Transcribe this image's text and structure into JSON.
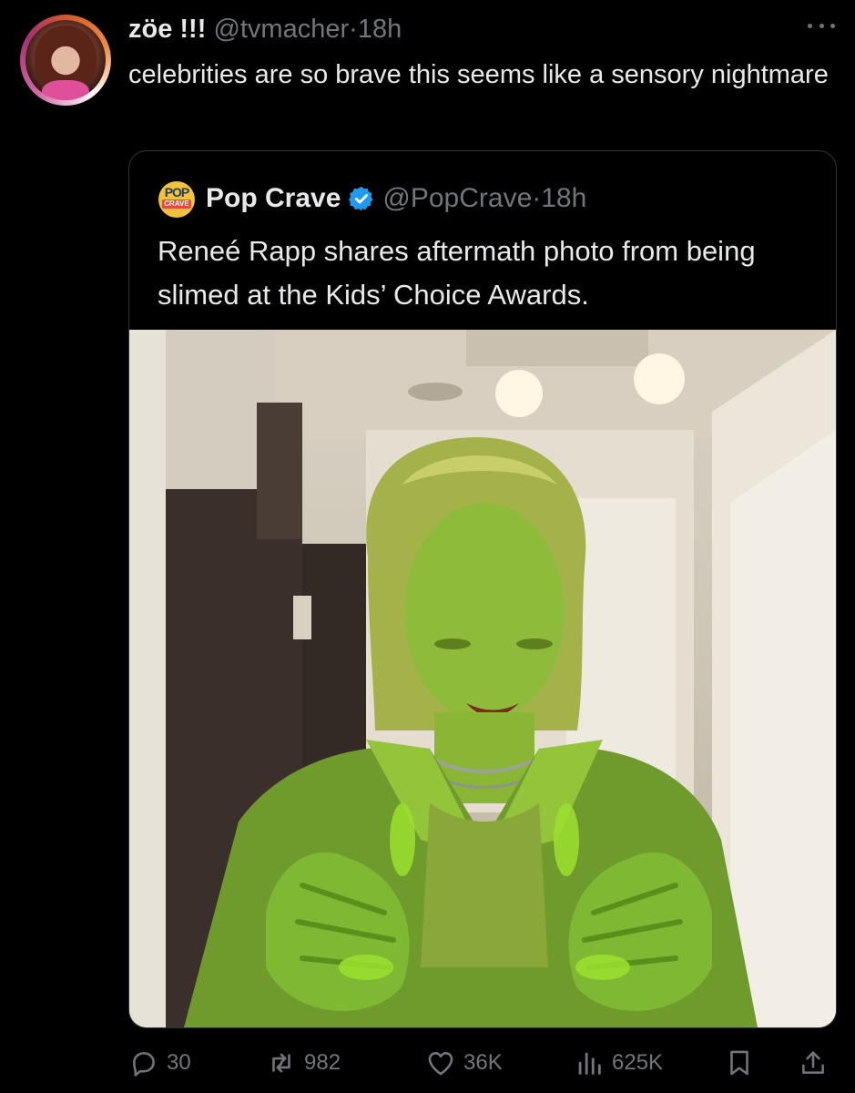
{
  "tweet": {
    "display_name": "zöe !!!",
    "handle": "@tvmacher",
    "separator": "·",
    "time": "18h",
    "text": "celebrities are so brave this seems like a sensory nightmare"
  },
  "quoted_tweet": {
    "logo_top": "POP",
    "logo_bottom": "CRAVE",
    "display_name": "Pop Crave",
    "handle": "@PopCrave",
    "separator": "·",
    "time": "18h",
    "text": "Reneé Rapp shares aftermath photo from being slimed at the Kids’ Choice Awards.",
    "verified_color": "#1d9bf0"
  },
  "actions": {
    "replies": "30",
    "reposts": "982",
    "likes": "36K",
    "views": "625K"
  },
  "icons": [
    "more-icon",
    "verified-icon",
    "reply-icon",
    "repost-icon",
    "like-icon",
    "views-icon",
    "bookmark-icon",
    "share-icon"
  ],
  "colors": {
    "background": "#000000",
    "text": "#e7e9ea",
    "secondary": "#71767b",
    "border": "#2f3336",
    "accent": "#1d9bf0",
    "slime": "#7ac42a"
  }
}
